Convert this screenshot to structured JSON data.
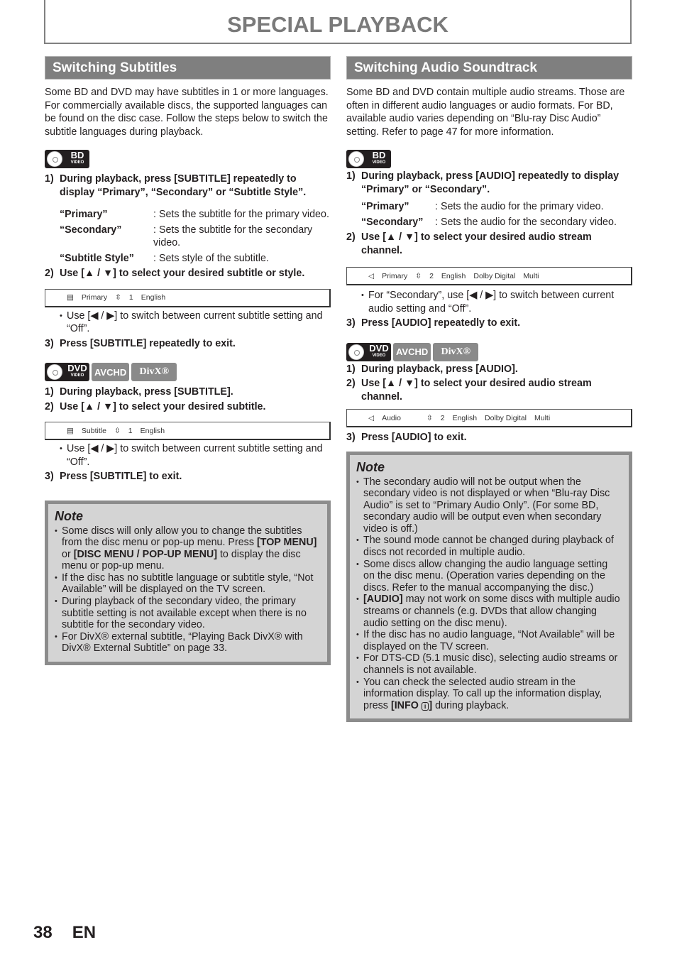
{
  "page_title": "SPECIAL PLAYBACK",
  "left": {
    "heading": "Switching Subtitles",
    "intro": "Some BD and DVD may have subtitles in 1 or more languages. For commercially available discs, the supported languages can be found on the disc case. Follow the steps below to switch the subtitle languages during playback.",
    "bd_section": {
      "badges": [
        {
          "label": "BD",
          "sub": "VIDEO",
          "icon": "bd-video-disc-icon"
        }
      ],
      "step1": {
        "num": "1)",
        "text": "During playback, press [SUBTITLE] repeatedly to display “Primary”, “Secondary” or “Subtitle Style”."
      },
      "definitions": [
        {
          "term": "“Primary”",
          "desc": ": Sets the subtitle for the primary video."
        },
        {
          "term": "“Secondary”",
          "desc": ": Sets the subtitle for the secondary video."
        },
        {
          "term": "“Subtitle Style”",
          "desc": ": Sets style of the subtitle."
        }
      ],
      "step2": {
        "num": "2)",
        "text": "Use [▲ / ▼] to select your desired subtitle or style."
      },
      "osd": {
        "icon": "subtitle-icon",
        "mode": "Primary",
        "arrow": "up-down-arrow-icon",
        "track": "1",
        "language": "English"
      },
      "bullet": "Use [◀ / ▶] to switch between current subtitle setting and “Off”.",
      "step3": {
        "num": "3)",
        "text": "Press [SUBTITLE] repeatedly to exit."
      }
    },
    "dvd_section": {
      "badges": [
        {
          "label": "DVD",
          "sub": "VIDEO",
          "icon": "dvd-video-disc-icon"
        },
        {
          "label": "AVCHD"
        },
        {
          "label": "DivX®"
        }
      ],
      "step1": {
        "num": "1)",
        "text": "During playback, press [SUBTITLE]."
      },
      "step2": {
        "num": "2)",
        "text": "Use [▲ / ▼] to select your desired subtitle."
      },
      "osd": {
        "icon": "subtitle-icon",
        "mode": "Subtitle",
        "arrow": "up-down-arrow-icon",
        "track": "1",
        "language": "English"
      },
      "bullet": "Use [◀ / ▶] to switch between current subtitle setting and “Off”.",
      "step3": {
        "num": "3)",
        "text": "Press [SUBTITLE] to exit."
      }
    },
    "note": {
      "heading": "Note",
      "items": [
        "Some discs will only allow you to change the subtitles from the disc menu or pop-up menu. Press [TOP MENU] or [DISC MENU / POP-UP MENU] to display the disc menu or pop-up menu.",
        "If the disc has no subtitle language or subtitle style, “Not Available” will be displayed on the TV screen.",
        "During playback of the secondary video, the primary subtitle setting is not available except when there is no subtitle for the secondary video.",
        "For DivX® external subtitle, “Playing Back DivX® with DivX® External Subtitle” on page 33."
      ]
    }
  },
  "right": {
    "heading": "Switching Audio Soundtrack",
    "intro": "Some BD and DVD contain multiple audio streams. Those are often in different audio languages or audio formats. For BD, available audio varies depending on “Blu-ray Disc Audio” setting. Refer to page 47 for more information.",
    "bd_section": {
      "badges": [
        {
          "label": "BD",
          "sub": "VIDEO",
          "icon": "bd-video-disc-icon"
        }
      ],
      "step1": {
        "num": "1)",
        "text": "During playback, press [AUDIO] repeatedly to display “Primary” or “Secondary”."
      },
      "definitions": [
        {
          "term": "“Primary”",
          "desc": ": Sets the audio for the primary video."
        },
        {
          "term": "“Secondary”",
          "desc": ": Sets the audio for the secondary video."
        }
      ],
      "step2": {
        "num": "2)",
        "text": "Use [▲ / ▼] to select your desired audio stream channel."
      },
      "osd": {
        "icon": "speaker-icon",
        "mode": "Primary",
        "arrow": "up-down-arrow-icon",
        "track": "2",
        "language": "English",
        "format": "Dolby Digital",
        "channels": "Multi"
      },
      "bullet": "For “Secondary”, use [◀ / ▶] to switch between current audio setting and “Off”.",
      "step3": {
        "num": "3)",
        "text": "Press [AUDIO] repeatedly to exit."
      }
    },
    "dvd_section": {
      "badges": [
        {
          "label": "DVD",
          "sub": "VIDEO",
          "icon": "dvd-video-disc-icon"
        },
        {
          "label": "AVCHD"
        },
        {
          "label": "DivX®"
        }
      ],
      "step1": {
        "num": "1)",
        "text": "During playback, press [AUDIO]."
      },
      "step2": {
        "num": "2)",
        "text": "Use [▲ / ▼] to select your desired audio stream channel."
      },
      "osd": {
        "icon": "speaker-icon",
        "mode": "Audio",
        "arrow": "up-down-arrow-icon",
        "track": "2",
        "language": "English",
        "format": "Dolby Digital",
        "channels": "Multi"
      },
      "step3": {
        "num": "3)",
        "text": "Press [AUDIO] to exit."
      }
    },
    "note": {
      "heading": "Note",
      "items": [
        "The secondary audio will not be output when the secondary video is not displayed or when “Blu-ray Disc Audio” is set to “Primary Audio Only”. (For some BD, secondary audio will be output even when secondary video is off.)",
        "The sound mode cannot be changed during playback of discs not recorded in multiple audio.",
        "Some discs allow changing the audio language setting on the disc menu. (Operation varies depending on the discs. Refer to the manual accompanying the disc.)",
        "[AUDIO] may not work on some discs with multiple audio streams or channels (e.g. DVDs that allow changing audio setting on the disc menu).",
        "If the disc has no audio language, “Not Available” will be displayed on the TV screen.",
        "For DTS-CD (5.1 music disc), selecting audio streams or channels is not available.",
        "You can check the selected audio stream in the information display. To call up the information display, press [INFO ⓘ] during playback."
      ]
    }
  },
  "footer": {
    "page_number": "38",
    "language": "EN"
  }
}
